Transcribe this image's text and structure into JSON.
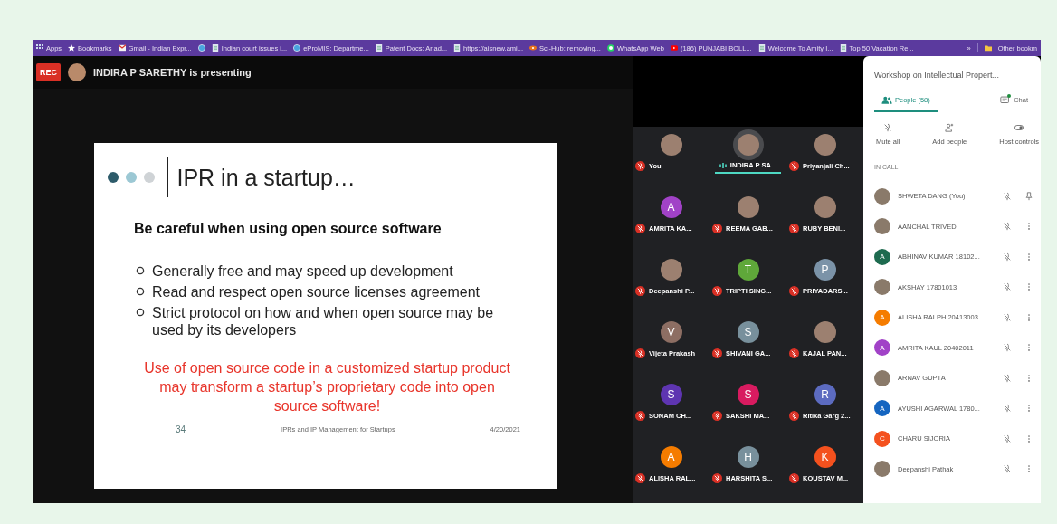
{
  "bookmarks": [
    {
      "kind": "apps",
      "label": "Apps"
    },
    {
      "kind": "star",
      "label": "Bookmarks"
    },
    {
      "kind": "mail",
      "label": "Gmail - Indian Expr..."
    },
    {
      "kind": "globe"
    },
    {
      "kind": "page",
      "label": "Indian court issues i..."
    },
    {
      "kind": "globe",
      "label": "eProMIS: Departme..."
    },
    {
      "kind": "page",
      "label": "Patent Docs: Ariad..."
    },
    {
      "kind": "page",
      "label": "https://aisnew.ami..."
    },
    {
      "kind": "eye",
      "label": "Sci-Hub: removing..."
    },
    {
      "kind": "chat",
      "label": "WhatsApp Web"
    },
    {
      "kind": "video",
      "label": "(186) PUNJABI BOLL..."
    },
    {
      "kind": "page",
      "label": "Welcome To Amity I..."
    },
    {
      "kind": "page",
      "label": "Top 50 Vacation Re..."
    }
  ],
  "bookmarks_overflow": "»",
  "other_bookmarks": "Other bookm",
  "recording": {
    "label": "REC"
  },
  "presenter": "INDIRA P SARETHY is presenting",
  "slide": {
    "title": "IPR in a startup…",
    "subtitle": "Be careful when using open source software",
    "bullets": [
      "Generally free and may speed up development",
      "Read and respect open source licenses agreement",
      "Strict protocol on how and when open source may be used by its developers"
    ],
    "note": "Use of open source code in a customized startup product may transform a startup’s proprietary code into open source software!",
    "number": "34",
    "footer": "IPRs and IP Management for Startups",
    "date": "4/20/2021"
  },
  "tiles": [
    {
      "name": "You",
      "muted": true,
      "speaking": false
    },
    {
      "name": "INDIRA P SA...",
      "muted": false,
      "speaking": true
    },
    {
      "name": "Priyanjali Ch...",
      "muted": true,
      "speaking": false
    },
    {
      "name": "AMRITA KA...",
      "letter": "A",
      "color": "#a142c7",
      "muted": true,
      "speaking": false
    },
    {
      "name": "REEMA GAB...",
      "muted": true,
      "speaking": false
    },
    {
      "name": "RUBY BENI...",
      "muted": true,
      "speaking": false
    },
    {
      "name": "Deepanshi P...",
      "muted": true,
      "speaking": false
    },
    {
      "name": "TRIPTI SING...",
      "letter": "T",
      "color": "#5fa83a",
      "muted": true,
      "speaking": false
    },
    {
      "name": "PRIYADARS...",
      "letter": "P",
      "color": "#7b93a8",
      "muted": true,
      "speaking": false
    },
    {
      "name": "Vijeta Prakash",
      "letter": "V",
      "color": "#8d6e63",
      "muted": true,
      "speaking": false
    },
    {
      "name": "SHIVANI GA...",
      "letter": "S",
      "color": "#78909c",
      "muted": true,
      "speaking": false
    },
    {
      "name": "KAJAL PAN...",
      "muted": true,
      "speaking": false
    },
    {
      "name": "SONAM CH...",
      "letter": "S",
      "color": "#5e35b1",
      "muted": true,
      "speaking": false
    },
    {
      "name": "SAKSHI MA...",
      "letter": "S",
      "color": "#d81b60",
      "muted": true,
      "speaking": false
    },
    {
      "name": "Ritika Garg 2...",
      "letter": "R",
      "color": "#5c6bc0",
      "muted": true,
      "speaking": false
    },
    {
      "name": "ALISHA RAL...",
      "letter": "A",
      "color": "#f57c00",
      "muted": true,
      "speaking": false
    },
    {
      "name": "HARSHITA S...",
      "letter": "H",
      "color": "#78909c",
      "muted": true,
      "speaking": false
    },
    {
      "name": "KOUSTAV M...",
      "letter": "K",
      "color": "#f4511e",
      "muted": true,
      "speaking": false
    }
  ],
  "panel": {
    "title": "Workshop on Intellectual Propert...",
    "tabs": [
      {
        "kind": "people",
        "label": "People (58)",
        "selected": true,
        "unread": false
      },
      {
        "kind": "chat",
        "label": "Chat",
        "selected": false,
        "unread": true
      }
    ],
    "actions": [
      {
        "kind": "mute",
        "label": "Mute all"
      },
      {
        "kind": "add",
        "label": "Add people"
      },
      {
        "kind": "toggle",
        "label": "Host controls"
      }
    ],
    "section": "IN CALL",
    "people": [
      {
        "name": "SHWETA DANG (You)",
        "kind": "pin"
      },
      {
        "name": "AANCHAL TRIVEDI",
        "kind": "menu"
      },
      {
        "name": "ABHINAV KUMAR 18102...",
        "letter": "A",
        "color": "#1e6b4f",
        "kind": "menu"
      },
      {
        "name": "AKSHAY 17801013",
        "kind": "menu"
      },
      {
        "name": "ALISHA RALPH 20413003",
        "letter": "A",
        "color": "#f57c00",
        "kind": "menu"
      },
      {
        "name": "AMRITA KAUL 20402011",
        "letter": "A",
        "color": "#a142c7",
        "kind": "menu"
      },
      {
        "name": "ARNAV GUPTA",
        "kind": "menu"
      },
      {
        "name": "AYUSHI AGARWAL 1780...",
        "letter": "A",
        "color": "#1565c0",
        "kind": "menu"
      },
      {
        "name": "CHARU SIJORIA",
        "letter": "C",
        "color": "#f4511e",
        "kind": "menu"
      },
      {
        "name": "Deepanshi Pathak",
        "kind": "menu"
      }
    ]
  }
}
